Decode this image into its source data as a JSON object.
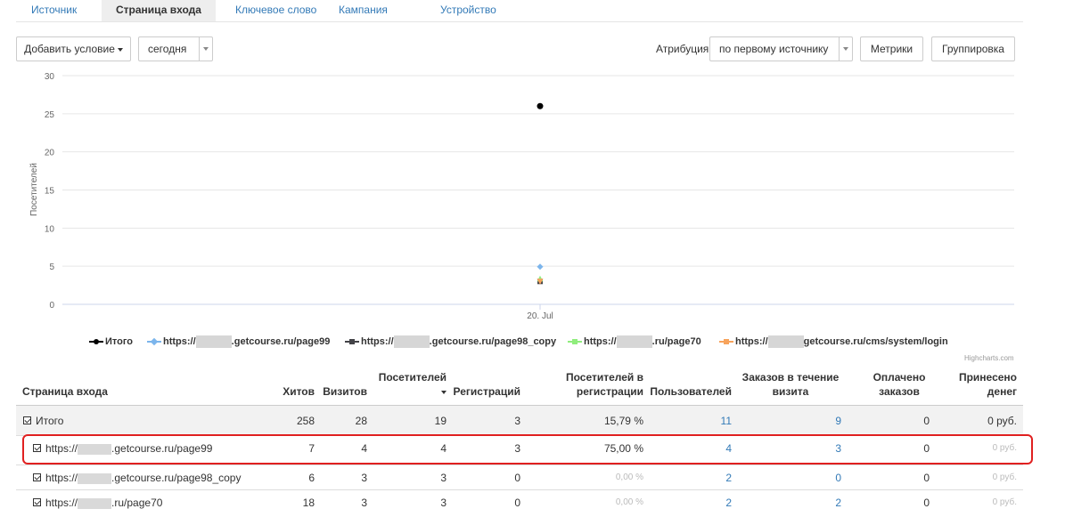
{
  "tabs": [
    "Источник",
    "Страница входа",
    "Ключевое слово",
    "Кампания",
    "Устройство"
  ],
  "toolbar": {
    "add_condition": "Добавить условие",
    "period": "сегодня",
    "attribution_label": "Атрибуция",
    "attribution_value": "по первому источнику",
    "metrics": "Метрики",
    "grouping": "Группировка"
  },
  "chart_data": {
    "type": "scatter",
    "ylabel": "Посетителей",
    "ylim": [
      0,
      30
    ],
    "yticks": [
      0,
      5,
      10,
      15,
      20,
      25,
      30
    ],
    "categories": [
      "20. Jul"
    ],
    "credit": "Highcharts.com",
    "series": [
      {
        "name": "Итого",
        "values": [
          26
        ],
        "color": "#000000",
        "marker": "circle"
      },
      {
        "name": "https://■.getcourse.ru/page99",
        "values": [
          4
        ],
        "color": "#7cb5ec",
        "marker": "diamond"
      },
      {
        "name": "https://■.getcourse.ru/page98_copy",
        "values": [
          3
        ],
        "color": "#434348",
        "marker": "square"
      },
      {
        "name": "https://■.ru/page70",
        "values": [
          3
        ],
        "color": "#90ed7d",
        "marker": "triangle"
      },
      {
        "name": "https://■getcourse.ru/cms/system/login",
        "values": [
          3
        ],
        "color": "#f7a35c",
        "marker": "triangle-down"
      }
    ]
  },
  "legend": [
    {
      "pre": "Итого",
      "post": ""
    },
    {
      "pre": "https://",
      "post": ".getcourse.ru/page99"
    },
    {
      "pre": "https://",
      "post": ".getcourse.ru/page98_copy"
    },
    {
      "pre": "https://",
      "post": ".ru/page70"
    },
    {
      "pre": "https://",
      "post": "getcourse.ru/cms/system/login"
    }
  ],
  "table": {
    "headers": {
      "page": "Страница входа",
      "hits": "Хитов",
      "visits": "Визитов",
      "visitors": "Посетителей",
      "regs": "Регистраций",
      "visitors_reg_1": "Посетителей в",
      "visitors_reg_2": "регистрации",
      "users": "Пользователей",
      "orders_1": "Заказов в течение",
      "orders_2": "визита",
      "paid_1": "Оплачено",
      "paid_2": "заказов",
      "money_1": "Принесено",
      "money_2": "денег"
    },
    "rows": [
      {
        "pre": "Итого",
        "post": "",
        "blur": false,
        "hits": "258",
        "visits": "28",
        "visitors": "19",
        "regs": "3",
        "conv": "15,79 %",
        "conv_muted": false,
        "users": "11",
        "orders": "9",
        "paid": "0",
        "money": "0 руб.",
        "money_muted": false
      },
      {
        "pre": "https://",
        "post": ".getcourse.ru/page99",
        "blur": true,
        "hits": "7",
        "visits": "4",
        "visitors": "4",
        "regs": "3",
        "conv": "75,00 %",
        "conv_muted": false,
        "users": "4",
        "orders": "3",
        "paid": "0",
        "money": "0 руб.",
        "money_muted": true
      },
      {
        "pre": "https://",
        "post": ".getcourse.ru/page98_copy",
        "blur": true,
        "hits": "6",
        "visits": "3",
        "visitors": "3",
        "regs": "0",
        "conv": "0,00 %",
        "conv_muted": true,
        "users": "2",
        "orders": "0",
        "paid": "0",
        "money": "0 руб.",
        "money_muted": true
      },
      {
        "pre": "https://",
        "post": ".ru/page70",
        "blur": true,
        "hits": "18",
        "visits": "3",
        "visitors": "3",
        "regs": "0",
        "conv": "0,00 %",
        "conv_muted": true,
        "users": "2",
        "orders": "2",
        "paid": "0",
        "money": "0 руб.",
        "money_muted": true
      }
    ]
  },
  "colors": {
    "link": "#337ab7",
    "highlight": "#e02020",
    "grid": "#e6e6e6"
  }
}
